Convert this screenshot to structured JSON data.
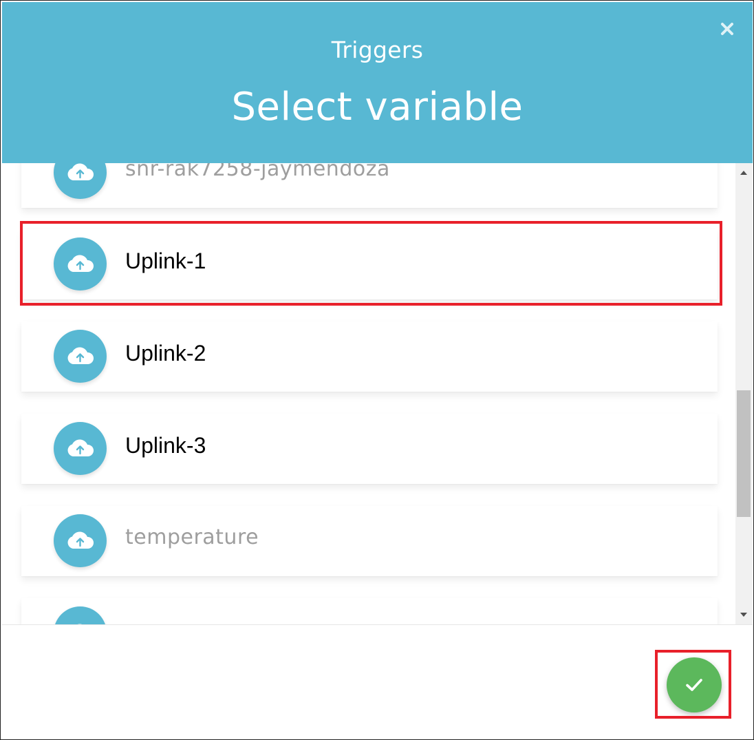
{
  "modal": {
    "subtitle": "Triggers",
    "title": "Select variable",
    "close_icon": "close-icon"
  },
  "variables": [
    {
      "label": "snr-rak7258-jaymendoza",
      "icon": "cloud-upload-icon"
    },
    {
      "label": "Uplink-1",
      "icon": "cloud-upload-icon"
    },
    {
      "label": "Uplink-2",
      "icon": "cloud-upload-icon"
    },
    {
      "label": "Uplink-3",
      "icon": "cloud-upload-icon"
    },
    {
      "label": "temperature",
      "icon": "cloud-upload-icon"
    },
    {
      "label": "",
      "icon": "cloud-upload-icon"
    }
  ],
  "footer": {
    "confirm_icon": "checkmark-icon"
  },
  "colors": {
    "header": "#58b8d3",
    "icon_circle": "#58b8d3",
    "confirm": "#5cb85c",
    "highlight": "#e8202a"
  }
}
